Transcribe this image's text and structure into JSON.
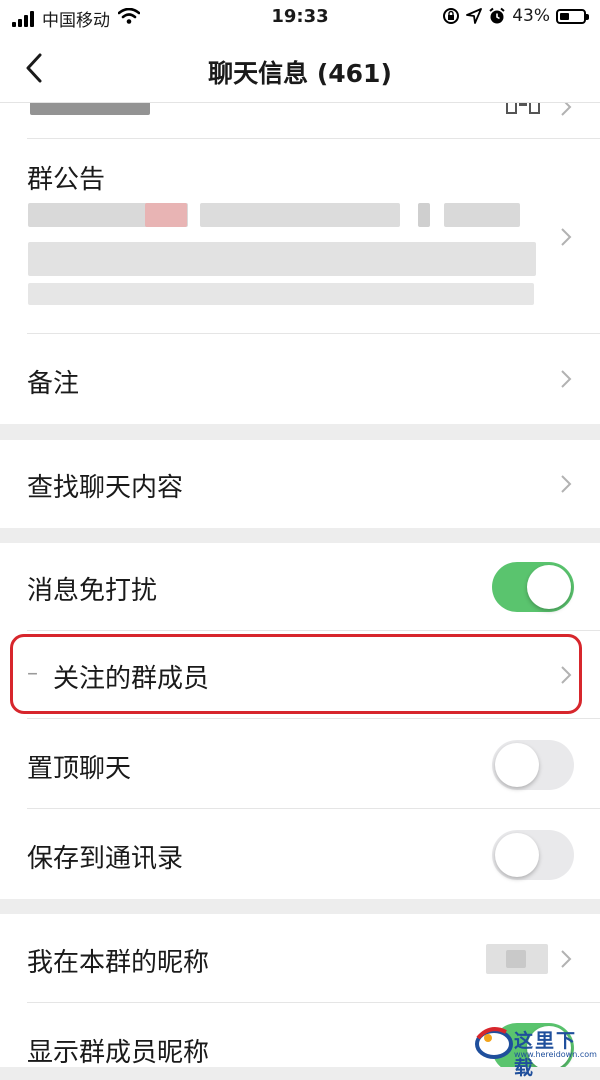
{
  "status": {
    "carrier": "中国移动",
    "time": "19:33",
    "battery": "43%",
    "battery_level": 0.43
  },
  "nav": {
    "title": "聊天信息 (461)"
  },
  "rows": {
    "announcement": "群公告",
    "remark": "备注",
    "search_chat": "查找聊天内容",
    "mute": "消息免打扰",
    "mute_on": true,
    "followed": "关注的群成员",
    "followed_dash": "–",
    "pin": "置顶聊天",
    "pin_on": false,
    "save_contacts": "保存到通讯录",
    "save_on": false,
    "my_nickname": "我在本群的昵称",
    "show_nicknames": "显示群成员昵称"
  },
  "watermark": {
    "text": "这里下载",
    "url": "www.hereidown.com"
  },
  "colors": {
    "toggle_on": "#5ac46e",
    "highlight": "#d7262c"
  }
}
